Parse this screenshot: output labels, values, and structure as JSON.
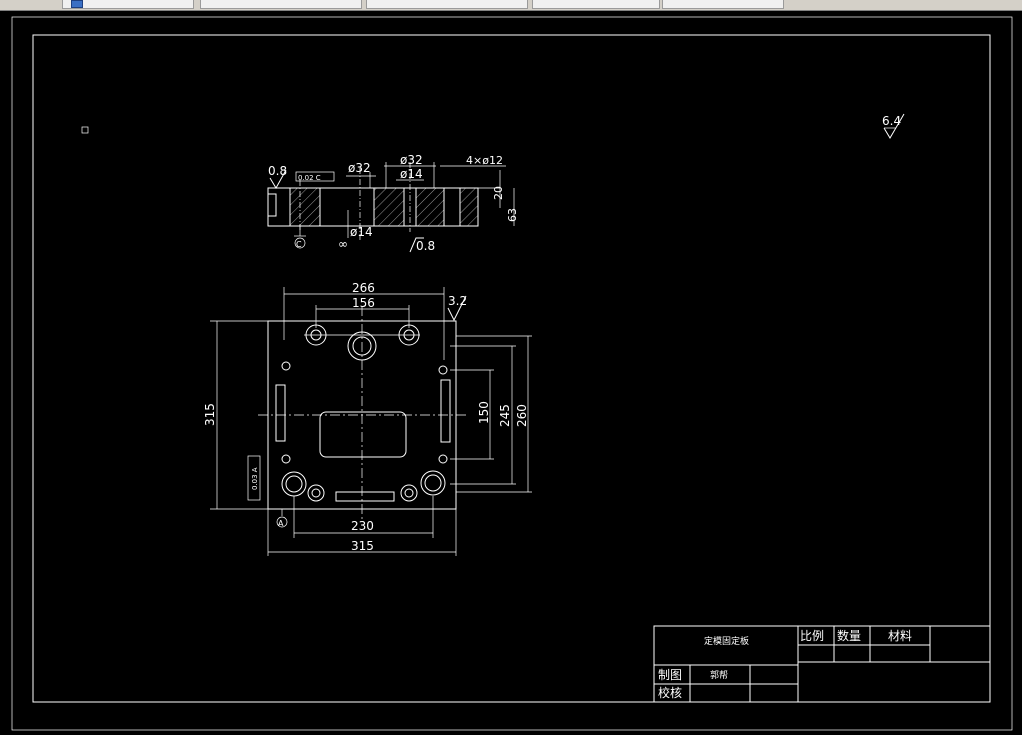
{
  "toolbar": {
    "tabs": [
      "",
      "",
      "",
      "",
      ""
    ]
  },
  "roughness": {
    "top_right": "6.4",
    "plan_corner": "3.2",
    "section_left": "0.8",
    "section_bottom": "0.8"
  },
  "section_dims": {
    "phi32_left": "ø32",
    "phi32_right": "ø32",
    "phi14": "ø14",
    "holes": "4×ø12",
    "dim20": "20",
    "dim63": "63",
    "phi14_bottom": "ø14",
    "datum_c": "C",
    "flatness_tol": "0.02 C"
  },
  "plan_dims": {
    "w266": "266",
    "w156": "156",
    "h315_left": "315",
    "h150": "150",
    "h245": "245",
    "h260": "260",
    "w230": "230",
    "w315_bottom": "315",
    "datum_a": "A",
    "parallel_tol": "0.03 A"
  },
  "title_block": {
    "part_name": "定模固定板",
    "scale_label": "比例",
    "quantity_label": "数量",
    "material_label": "材料",
    "drawn_label": "制图",
    "drawn_by": "郭帮",
    "checked_label": "校核"
  }
}
